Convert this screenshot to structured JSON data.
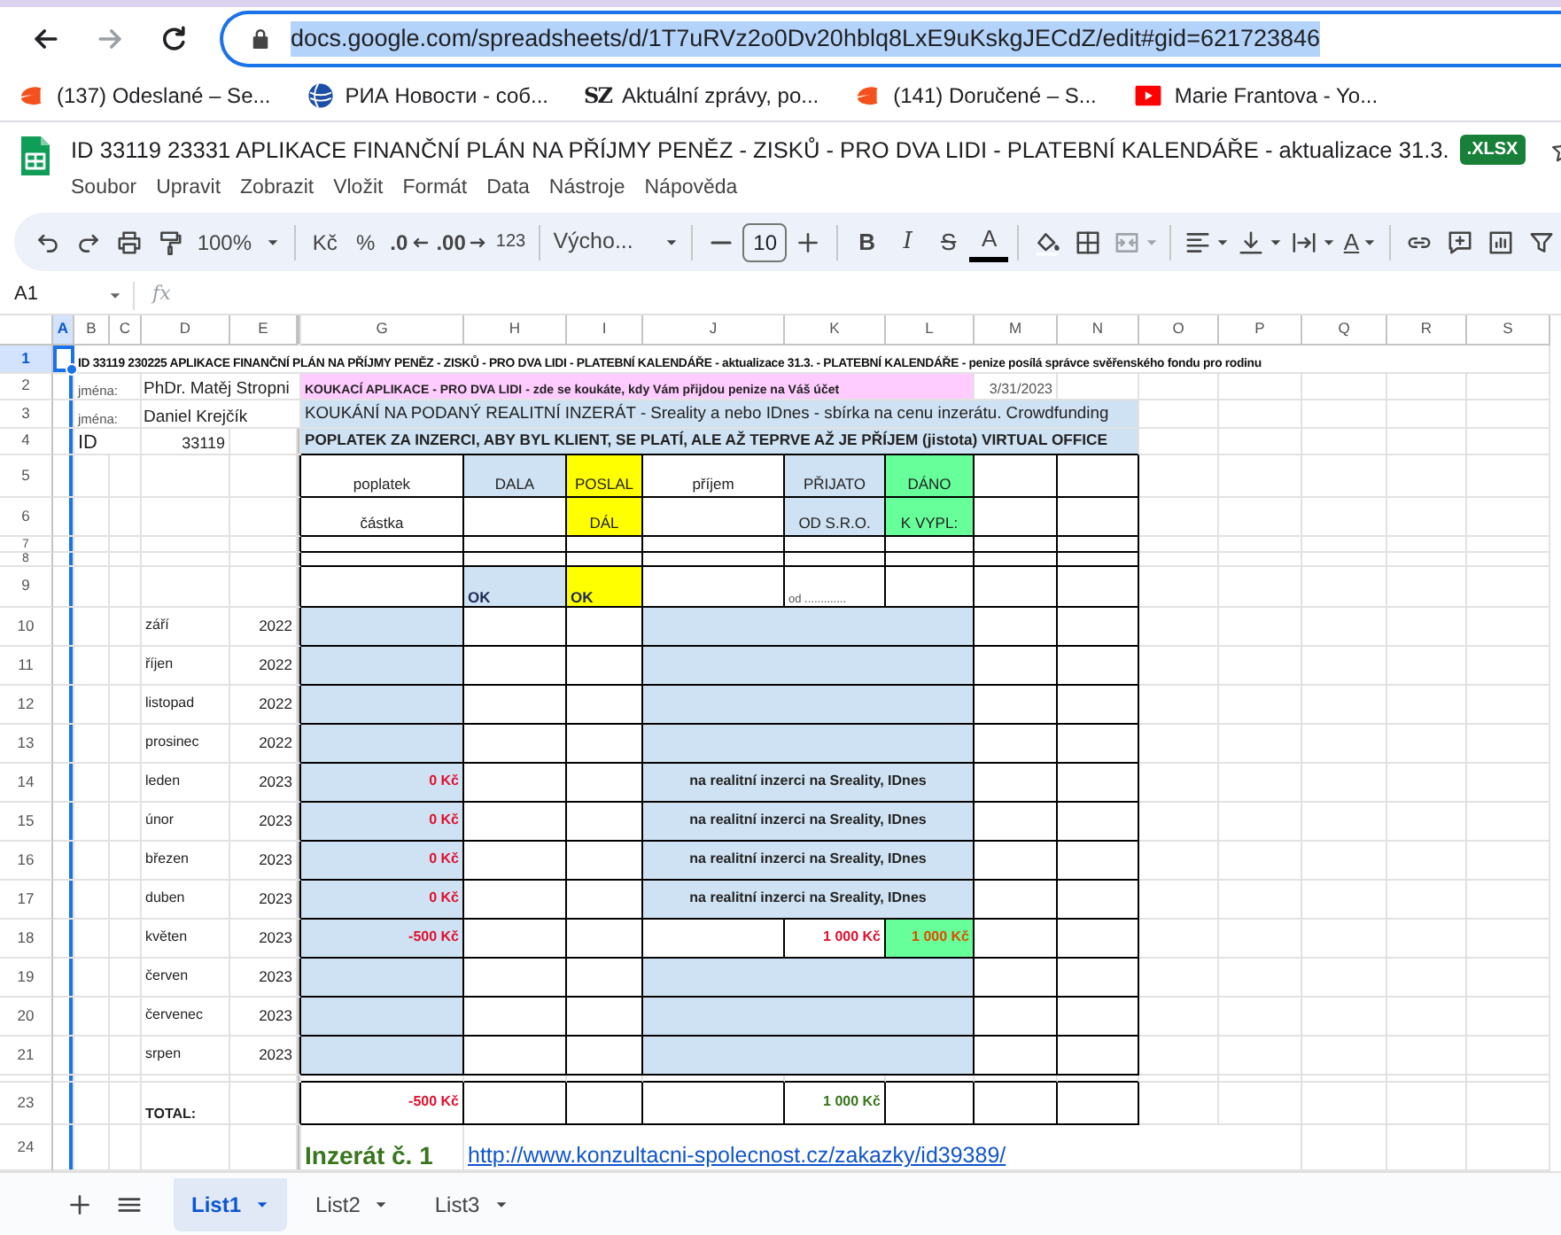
{
  "browser": {
    "url": "docs.google.com/spreadsheets/d/1T7uRVz2o0Dv20hblq8LxE9uKskgJECdZ/edit#gid=621723846",
    "url_selected": true,
    "bookmarks": [
      {
        "kind": "mail",
        "label": "(137) Odeslané – Se..."
      },
      {
        "kind": "globe",
        "label": "РИА Новости - соб..."
      },
      {
        "kind": "logo",
        "logo": "SZ",
        "label": "Aktuální zprávy, po..."
      },
      {
        "kind": "mail",
        "label": "(141) Doručené – S..."
      },
      {
        "kind": "video",
        "label": "Marie Frantova - Yo..."
      }
    ]
  },
  "document": {
    "title": "ID 33119 23331 APLIKACE FINANČNÍ PLÁN NA PŘÍJMY PENĚZ - ZISKŮ - PRO DVA LIDI - PLATEBNÍ KALENDÁŘE - aktualizace 31.3.",
    "badge": ".XLSX",
    "menu": [
      "Soubor",
      "Upravit",
      "Zobrazit",
      "Vložit",
      "Formát",
      "Data",
      "Nástroje",
      "Nápověda"
    ]
  },
  "toolbar": {
    "zoom": "100%",
    "currency": "Kč",
    "percent": "%",
    "decimal_decrease": ".0",
    "decimal_increase": ".00",
    "number_formats": "123",
    "font": "Výcho...",
    "font_size": "10",
    "bold": "B",
    "italic": "I",
    "strikethrough": "S",
    "text_color": "A",
    "rotation": "A",
    "merge_disabled": true
  },
  "formula_bar": {
    "cell": "A1",
    "fx": "fx"
  },
  "sheet": {
    "columns": [
      {
        "label": "A",
        "selected": true
      },
      {
        "label": "B",
        "selected": false
      },
      {
        "label": "C",
        "selected": false
      },
      {
        "label": "D",
        "selected": false
      },
      {
        "label": "E",
        "selected": false
      },
      {
        "label": "G",
        "selected": false
      },
      {
        "label": "H",
        "selected": false
      },
      {
        "label": "I",
        "selected": false
      },
      {
        "label": "J",
        "selected": false
      },
      {
        "label": "K",
        "selected": false
      },
      {
        "label": "L",
        "selected": false
      },
      {
        "label": "M",
        "selected": false
      },
      {
        "label": "N",
        "selected": false
      },
      {
        "label": "O",
        "selected": false
      },
      {
        "label": "P",
        "selected": false
      },
      {
        "label": "Q",
        "selected": false
      },
      {
        "label": "R",
        "selected": false
      },
      {
        "label": "S",
        "selected": false
      }
    ],
    "rows": [
      {
        "number": "1",
        "selected": true,
        "cells": [
          {
            "kind": "caption",
            "text": "ID 33119 230225 APLIKACE FINANČNÍ PLÁN NA PŘÍJMY PENĚZ - ZISKŮ - PRO DVA LIDI - PLATEBNÍ KALENDÁŘE - aktualizace 31.3. - PLATEBNÍ KALENDÁŘE - penize posílá správce svěřenského fondu pro rodinu"
          }
        ]
      },
      {
        "number": "2",
        "selected": false,
        "cells": [
          {
            "kind": "hint",
            "text": "jména:"
          },
          {
            "kind": "name",
            "text": "PhDr. Matěj Stropni"
          },
          {
            "kind": "banner",
            "text": "KOUKACÍ APLIKACE - PRO DVA LIDI - zde se koukáte, kdy Vám přijdou penize na Váš účet",
            "color": "#ffccff"
          },
          {
            "kind": "date",
            "text": "3/31/2023"
          }
        ]
      },
      {
        "number": "3",
        "selected": false,
        "cells": [
          {
            "kind": "hint",
            "text": "jména:"
          },
          {
            "kind": "name",
            "text": "Daniel Krejčík"
          },
          {
            "kind": "subtitle",
            "text": "KOUKÁNÍ NA PODANÝ REALITNÍ INZERÁT -  Sreality a nebo IDnes - sbírka na cenu inzerátu. Crowdfunding",
            "color": "#cfe2f3"
          }
        ]
      },
      {
        "number": "4",
        "selected": false,
        "cells": [
          {
            "kind": "id",
            "text": "ID"
          },
          {
            "kind": "number",
            "text": "33119"
          },
          {
            "kind": "notice",
            "text": "POPLATEK ZA INZERCI, ABY BYL KLIENT, SE PLATÍ, ALE AŽ TEPRVE AŽ JE PŘÍJEM (jistota) VIRTUAL OFFICE",
            "color": "#cfe2f3"
          }
        ]
      },
      {
        "number": "5",
        "selected": false,
        "cells": [
          {
            "kind": "head",
            "text": "poplatek"
          },
          {
            "kind": "head",
            "text": "DALA",
            "color": "#cfe2f3"
          },
          {
            "kind": "head",
            "text": "POSLAL",
            "color": "#ffff00"
          },
          {
            "kind": "head",
            "text": "příjem"
          },
          {
            "kind": "head",
            "text": "PŘIJATO",
            "color": "#cfe2f3"
          },
          {
            "kind": "head",
            "text": "DÁNO",
            "color": "#66ff99"
          }
        ]
      },
      {
        "number": "6",
        "selected": false,
        "cells": [
          {
            "kind": "head",
            "text": "částka"
          },
          {
            "kind": "head",
            "text": "DÁL",
            "color": "#ffff00"
          },
          {
            "kind": "head",
            "text": "OD S.R.O.",
            "color": "#cfe2f3"
          },
          {
            "kind": "head",
            "text": "K VYPL:",
            "color": "#66ff99"
          }
        ]
      },
      {
        "number": "7",
        "selected": false
      },
      {
        "number": "8",
        "selected": false
      },
      {
        "number": "9",
        "selected": false,
        "cells": [
          {
            "kind": "ok",
            "text": "OK",
            "color": "#cfe2f3"
          },
          {
            "kind": "ok",
            "text": "OK",
            "color": "#ffff00"
          },
          {
            "kind": "tiny",
            "text": "od ............."
          }
        ]
      },
      {
        "number": "10",
        "selected": false,
        "cells": [
          {
            "kind": "month",
            "text": "září"
          },
          {
            "kind": "year",
            "text": "2022"
          },
          {
            "kind": "expense",
            "color": "#cfe2f3"
          },
          {
            "kind": "note",
            "color": "#cfe2f3"
          }
        ]
      },
      {
        "number": "11",
        "selected": false,
        "cells": [
          {
            "kind": "month",
            "text": "říjen"
          },
          {
            "kind": "year",
            "text": "2022"
          },
          {
            "kind": "expense",
            "color": "#cfe2f3"
          },
          {
            "kind": "note",
            "color": "#cfe2f3"
          }
        ]
      },
      {
        "number": "12",
        "selected": false,
        "cells": [
          {
            "kind": "month",
            "text": "listopad"
          },
          {
            "kind": "year",
            "text": "2022"
          },
          {
            "kind": "expense",
            "color": "#cfe2f3"
          },
          {
            "kind": "note",
            "color": "#cfe2f3"
          }
        ]
      },
      {
        "number": "13",
        "selected": false,
        "cells": [
          {
            "kind": "month",
            "text": "prosinec"
          },
          {
            "kind": "year",
            "text": "2022"
          },
          {
            "kind": "expense",
            "color": "#cfe2f3"
          },
          {
            "kind": "note",
            "color": "#cfe2f3"
          }
        ]
      },
      {
        "number": "14",
        "selected": false,
        "cells": [
          {
            "kind": "month",
            "text": "leden"
          },
          {
            "kind": "year",
            "text": "2023"
          },
          {
            "kind": "expense",
            "text": "0 Kč",
            "color": "#cfe2f3"
          },
          {
            "kind": "note",
            "text": "na realitní inzerci na Sreality, IDnes",
            "color": "#cfe2f3"
          }
        ]
      },
      {
        "number": "15",
        "selected": false,
        "cells": [
          {
            "kind": "month",
            "text": "únor"
          },
          {
            "kind": "year",
            "text": "2023"
          },
          {
            "kind": "expense",
            "text": "0 Kč",
            "color": "#cfe2f3"
          },
          {
            "kind": "note",
            "text": "na realitní inzerci na Sreality, IDnes",
            "color": "#cfe2f3"
          }
        ]
      },
      {
        "number": "16",
        "selected": false,
        "cells": [
          {
            "kind": "month",
            "text": "březen"
          },
          {
            "kind": "year",
            "text": "2023"
          },
          {
            "kind": "expense",
            "text": "0 Kč",
            "color": "#cfe2f3"
          },
          {
            "kind": "note",
            "text": "na realitní inzerci na Sreality, IDnes",
            "color": "#cfe2f3"
          }
        ]
      },
      {
        "number": "17",
        "selected": false,
        "cells": [
          {
            "kind": "month",
            "text": "duben"
          },
          {
            "kind": "year",
            "text": "2023"
          },
          {
            "kind": "expense",
            "text": "0 Kč",
            "color": "#cfe2f3"
          },
          {
            "kind": "note",
            "text": "na realitní inzerci na Sreality, IDnes",
            "color": "#cfe2f3"
          }
        ]
      },
      {
        "number": "18",
        "selected": false,
        "cells": [
          {
            "kind": "month",
            "text": "květen"
          },
          {
            "kind": "year",
            "text": "2023"
          },
          {
            "kind": "expense",
            "text": "-500 Kč",
            "color": "#cfe2f3"
          },
          {
            "kind": "receipt",
            "text": "1 000 Kč"
          },
          {
            "kind": "payout",
            "text": "1 000 Kč",
            "color": "#66ff99"
          }
        ]
      },
      {
        "number": "19",
        "selected": false,
        "cells": [
          {
            "kind": "month",
            "text": "červen"
          },
          {
            "kind": "year",
            "text": "2023"
          },
          {
            "kind": "expense",
            "color": "#cfe2f3"
          },
          {
            "kind": "note",
            "color": "#cfe2f3"
          }
        ]
      },
      {
        "number": "20",
        "selected": false,
        "cells": [
          {
            "kind": "month",
            "text": "červenec"
          },
          {
            "kind": "year",
            "text": "2023"
          },
          {
            "kind": "expense",
            "color": "#cfe2f3"
          },
          {
            "kind": "note",
            "color": "#cfe2f3"
          }
        ]
      },
      {
        "number": "21",
        "selected": false,
        "cells": [
          {
            "kind": "month",
            "text": "srpen"
          },
          {
            "kind": "year",
            "text": "2023"
          },
          {
            "kind": "expense",
            "color": "#cfe2f3"
          },
          {
            "kind": "note",
            "color": "#cfe2f3"
          }
        ]
      },
      {
        "selected": false
      },
      {
        "number": "23",
        "selected": false,
        "cells": [
          {
            "kind": "total",
            "text": "TOTAL:"
          },
          {
            "kind": "expense",
            "text": "-500 Kč"
          },
          {
            "kind": "income",
            "text": "1 000 Kč"
          }
        ]
      },
      {
        "number": "24",
        "selected": false,
        "cells": [
          {
            "kind": "ad",
            "text": "Inzerát č. 1"
          },
          {
            "kind": "link",
            "text": "http://www.konzultacni-spolecnost.cz/zakazky/id39389/"
          }
        ]
      }
    ]
  },
  "sheet_tabs": [
    {
      "label": "List1",
      "selected": true
    },
    {
      "label": "List2",
      "selected": false
    },
    {
      "label": "List3",
      "selected": false
    }
  ]
}
